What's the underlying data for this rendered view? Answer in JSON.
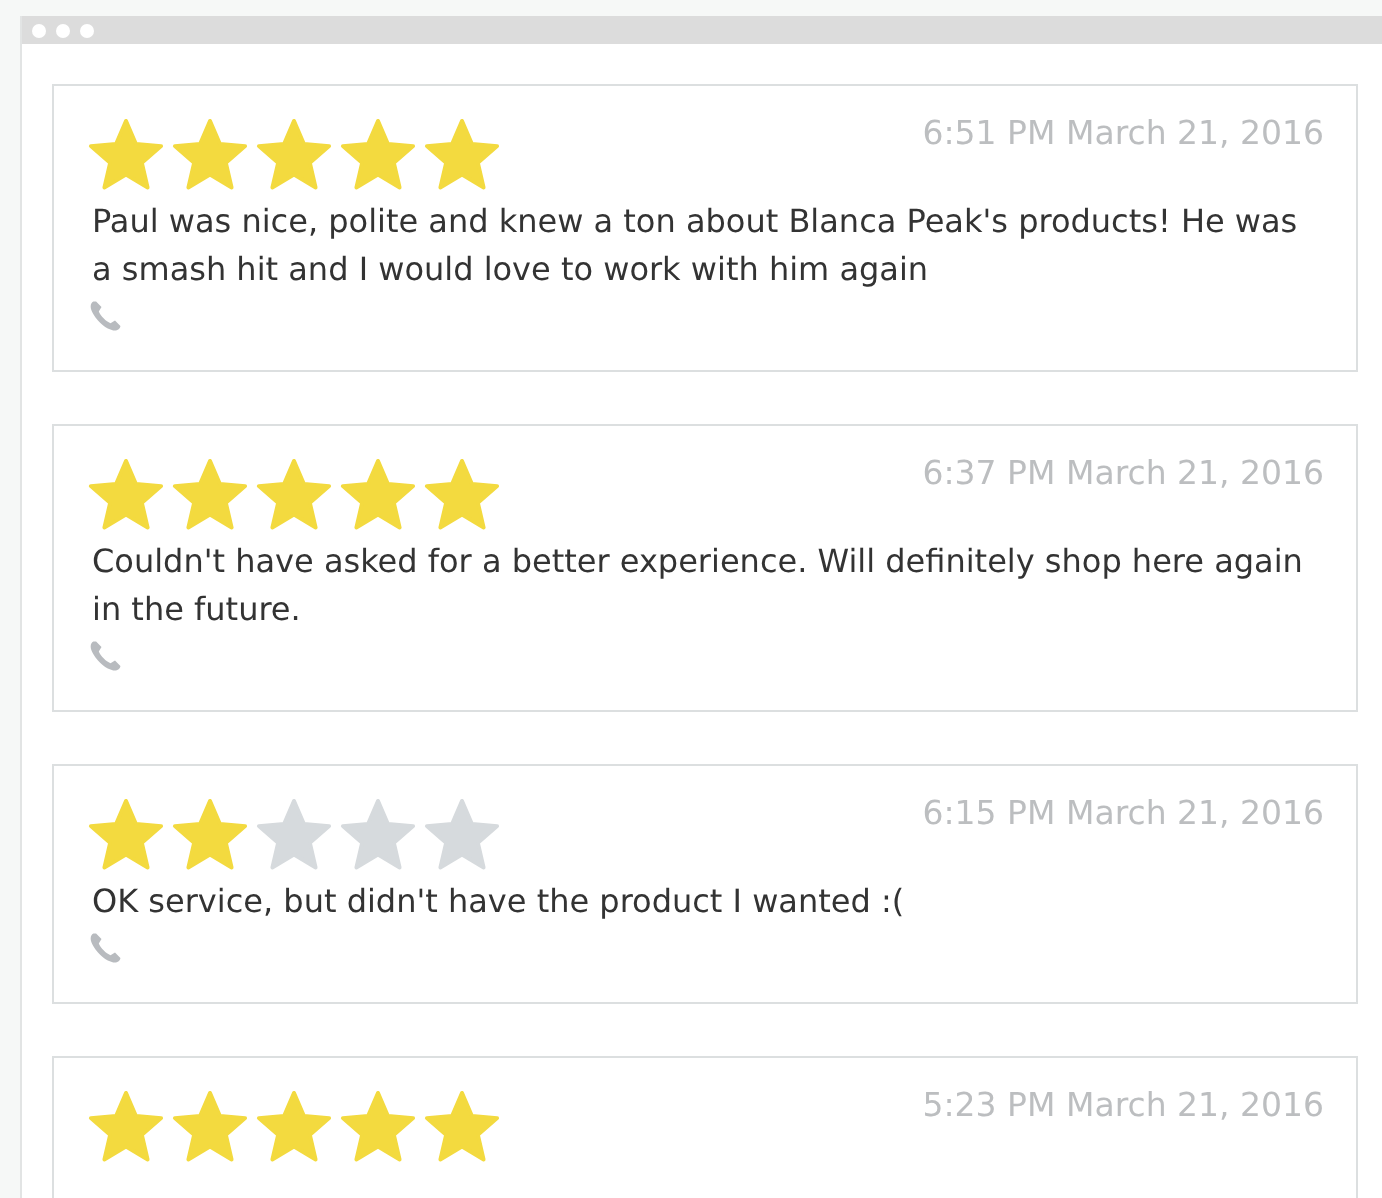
{
  "reviews": [
    {
      "stars": 5,
      "time": "6:51 PM March 21, 2016",
      "text": "Paul was nice, polite and knew a ton about Blanca Peak's products! He was a smash hit and I would love to work with him again"
    },
    {
      "stars": 5,
      "time": "6:37 PM March 21, 2016",
      "text": "Couldn't have asked for a better experience. Will definitely shop here again in the future."
    },
    {
      "stars": 2,
      "time": "6:15 PM March 21, 2016",
      "text": "OK service, but didn't have the product I wanted :("
    },
    {
      "stars": 5,
      "time": "5:23 PM March 21, 2016"
    }
  ]
}
